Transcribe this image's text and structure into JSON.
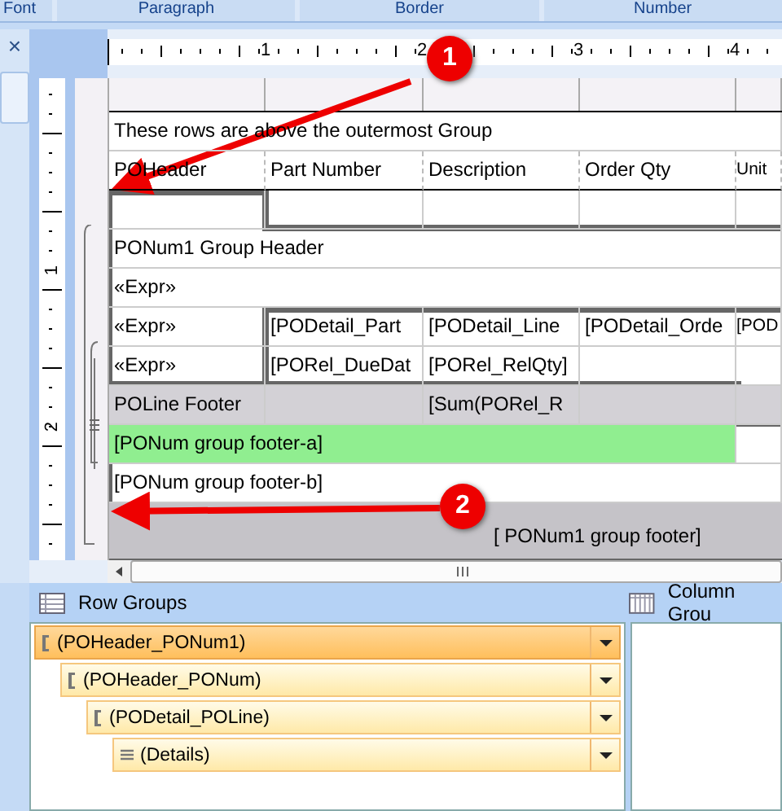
{
  "ribbon": {
    "groups": [
      "Font",
      "Paragraph",
      "Border",
      "Number"
    ]
  },
  "ruler": {
    "h_labels": [
      "1",
      "2",
      "3",
      "4"
    ],
    "v_labels": [
      "1",
      "2"
    ]
  },
  "sidebar": {
    "close": "×"
  },
  "table": {
    "rows": [
      {
        "kind": "full",
        "cells": [
          {
            "text": "These rows are above the outermost Group"
          }
        ]
      },
      {
        "kind": "dotted",
        "cells": [
          {
            "text": "POHeader"
          },
          {
            "text": "Part Number"
          },
          {
            "text": "Description"
          },
          {
            "text": "Order Qty"
          },
          {
            "text": "Unit"
          }
        ]
      },
      {
        "kind": "plain",
        "cells": [
          {},
          {},
          {},
          {},
          {}
        ]
      },
      {
        "kind": "full",
        "cells": [
          {
            "text": "PONum1 Group Header"
          }
        ]
      },
      {
        "kind": "full",
        "cells": [
          {
            "text": "«Expr»"
          }
        ]
      },
      {
        "kind": "plain",
        "cells": [
          {
            "text": "«Expr»"
          },
          {
            "text": "[PODetail_Part"
          },
          {
            "text": "[PODetail_Line"
          },
          {
            "text": "[PODetail_Orde"
          },
          {
            "text": "[POD"
          }
        ]
      },
      {
        "kind": "plain",
        "cells": [
          {
            "text": "«Expr»"
          },
          {
            "text": "[PORel_DueDat"
          },
          {
            "text": "[PORel_RelQty]"
          },
          {},
          {}
        ]
      },
      {
        "kind": "gray",
        "cells": [
          {
            "text": "POLine Footer"
          },
          {},
          {
            "text": "[Sum(PORel_R"
          },
          {},
          {}
        ]
      },
      {
        "kind": "highlight",
        "cells": [
          {
            "text": "[PONum group footer-a]"
          },
          {}
        ]
      },
      {
        "kind": "full",
        "cells": [
          {
            "text": "[PONum group footer-b]"
          }
        ]
      },
      {
        "kind": "footer",
        "cells": [
          {},
          {},
          {
            "text": "[ PONum1 group footer]"
          }
        ]
      }
    ]
  },
  "callouts": [
    {
      "label": "1"
    },
    {
      "label": "2"
    }
  ],
  "row_groups": {
    "title": "Row Groups",
    "items": [
      {
        "label": "(POHeader_PONum1)",
        "kind": "group",
        "selected": true,
        "children": [
          {
            "label": "(POHeader_PONum)",
            "kind": "group",
            "selected": false,
            "children": [
              {
                "label": "(PODetail_POLine)",
                "kind": "group",
                "selected": false,
                "children": [
                  {
                    "label": "(Details)",
                    "kind": "details",
                    "selected": false
                  }
                ]
              }
            ]
          }
        ]
      }
    ]
  },
  "column_groups": {
    "title": "Column Grou"
  }
}
